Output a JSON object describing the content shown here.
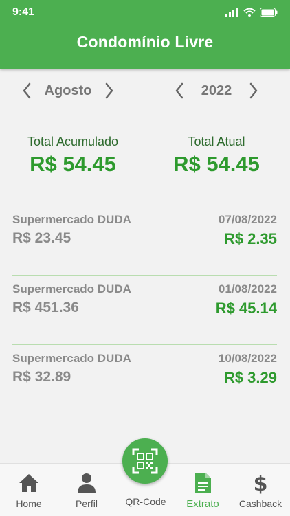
{
  "status_bar": {
    "time": "9:41"
  },
  "header": {
    "title": "Condomínio Livre"
  },
  "month_selector": {
    "value": "Agosto"
  },
  "year_selector": {
    "value": "2022"
  },
  "totals": {
    "accumulated_label": "Total Acumulado",
    "accumulated_value": "R$ 54.45",
    "current_label": "Total Atual",
    "current_value": "R$ 54.45"
  },
  "transactions": [
    {
      "store": "Supermercado DUDA",
      "amount": "R$ 23.45",
      "date": "07/08/2022",
      "cashback": "R$ 2.35"
    },
    {
      "store": "Supermercado DUDA",
      "amount": "R$ 451.36",
      "date": "01/08/2022",
      "cashback": "R$ 45.14"
    },
    {
      "store": "Supermercado DUDA",
      "amount": "R$ 32.89",
      "date": "10/08/2022",
      "cashback": "R$ 3.29"
    }
  ],
  "nav": {
    "home": "Home",
    "profile": "Perfil",
    "qrcode": "QR-Code",
    "statement": "Extrato",
    "cashback": "Cashback",
    "active": "statement"
  },
  "colors": {
    "primary": "#4caf50",
    "value_green": "#2e9a2e",
    "label_green": "#2e6b2e",
    "text_gray": "#8a8a8a",
    "background": "#f2f2f2"
  },
  "icons": {
    "home": "home-icon",
    "profile": "person-icon",
    "qrcode": "qr-code-icon",
    "statement": "document-icon",
    "cashback": "dollar-icon"
  }
}
